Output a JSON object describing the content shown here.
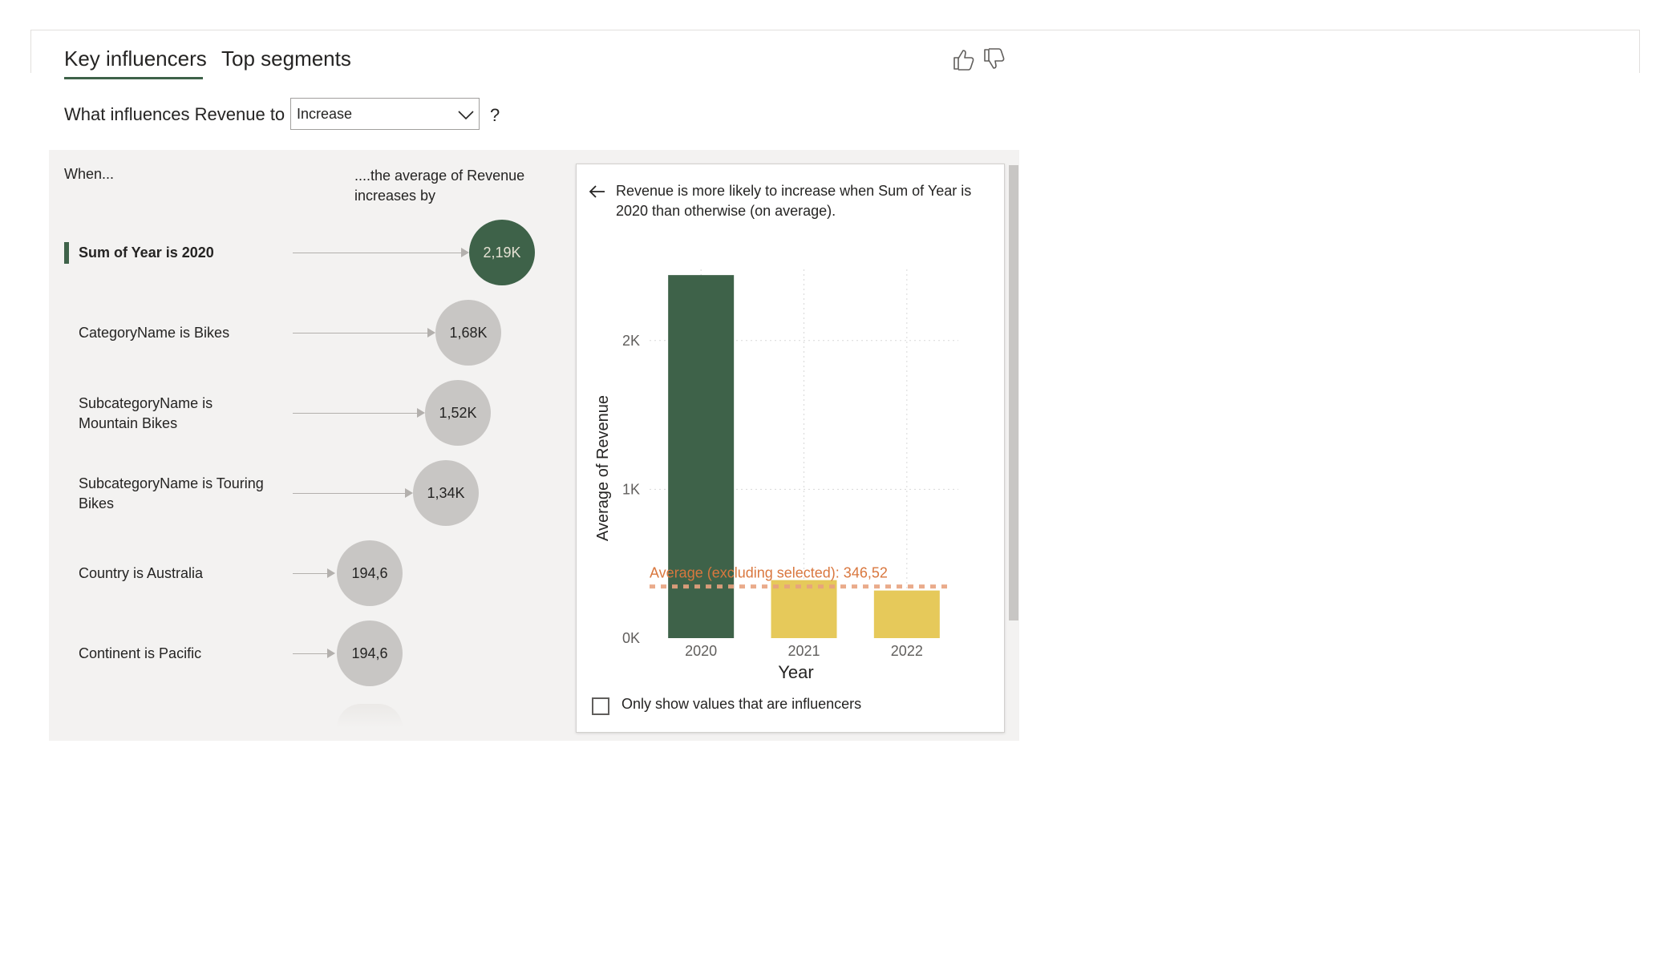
{
  "tabs": {
    "key_influencers": "Key influencers",
    "top_segments": "Top segments"
  },
  "question": {
    "label": "What influences Revenue to",
    "dropdown_value": "Increase",
    "suffix": "?"
  },
  "columns": {
    "when": "When...",
    "avg": "....the average of Revenue increases by"
  },
  "influencers": [
    {
      "label": "Sum of Year is 2020",
      "value": "2,19K"
    },
    {
      "label": "CategoryName is Bikes",
      "value": "1,68K"
    },
    {
      "label": "SubcategoryName is Mountain Bikes",
      "value": "1,52K"
    },
    {
      "label": "SubcategoryName is Touring Bikes",
      "value": "1,34K"
    },
    {
      "label": "Country is Australia",
      "value": "194,6"
    },
    {
      "label": "Continent is Pacific",
      "value": "194,6"
    }
  ],
  "detail": {
    "text": "Revenue is more likely to increase when Sum of Year is 2020 than otherwise (on average).",
    "checkbox_label": "Only show values that are influencers"
  },
  "colors": {
    "selected": "#3e6249",
    "other": "#e6c95a",
    "average_line": "#e8a27f",
    "average_text": "#d9773e"
  },
  "icons": [
    "thumbs-up-icon",
    "thumbs-down-icon",
    "chevron-down-icon",
    "back-arrow-icon"
  ],
  "chart_data": {
    "type": "bar",
    "categories": [
      "2020",
      "2021",
      "2022"
    ],
    "values": [
      2440,
      390,
      320
    ],
    "selected_category": "2020",
    "xlabel": "Year",
    "ylabel": "Average of Revenue",
    "yticks": [
      "0K",
      "1K",
      "2K"
    ],
    "ylim": [
      0,
      2500
    ],
    "average_line": {
      "value": 346.52,
      "label": "Average (excluding selected): 346,52"
    },
    "grid": true
  }
}
